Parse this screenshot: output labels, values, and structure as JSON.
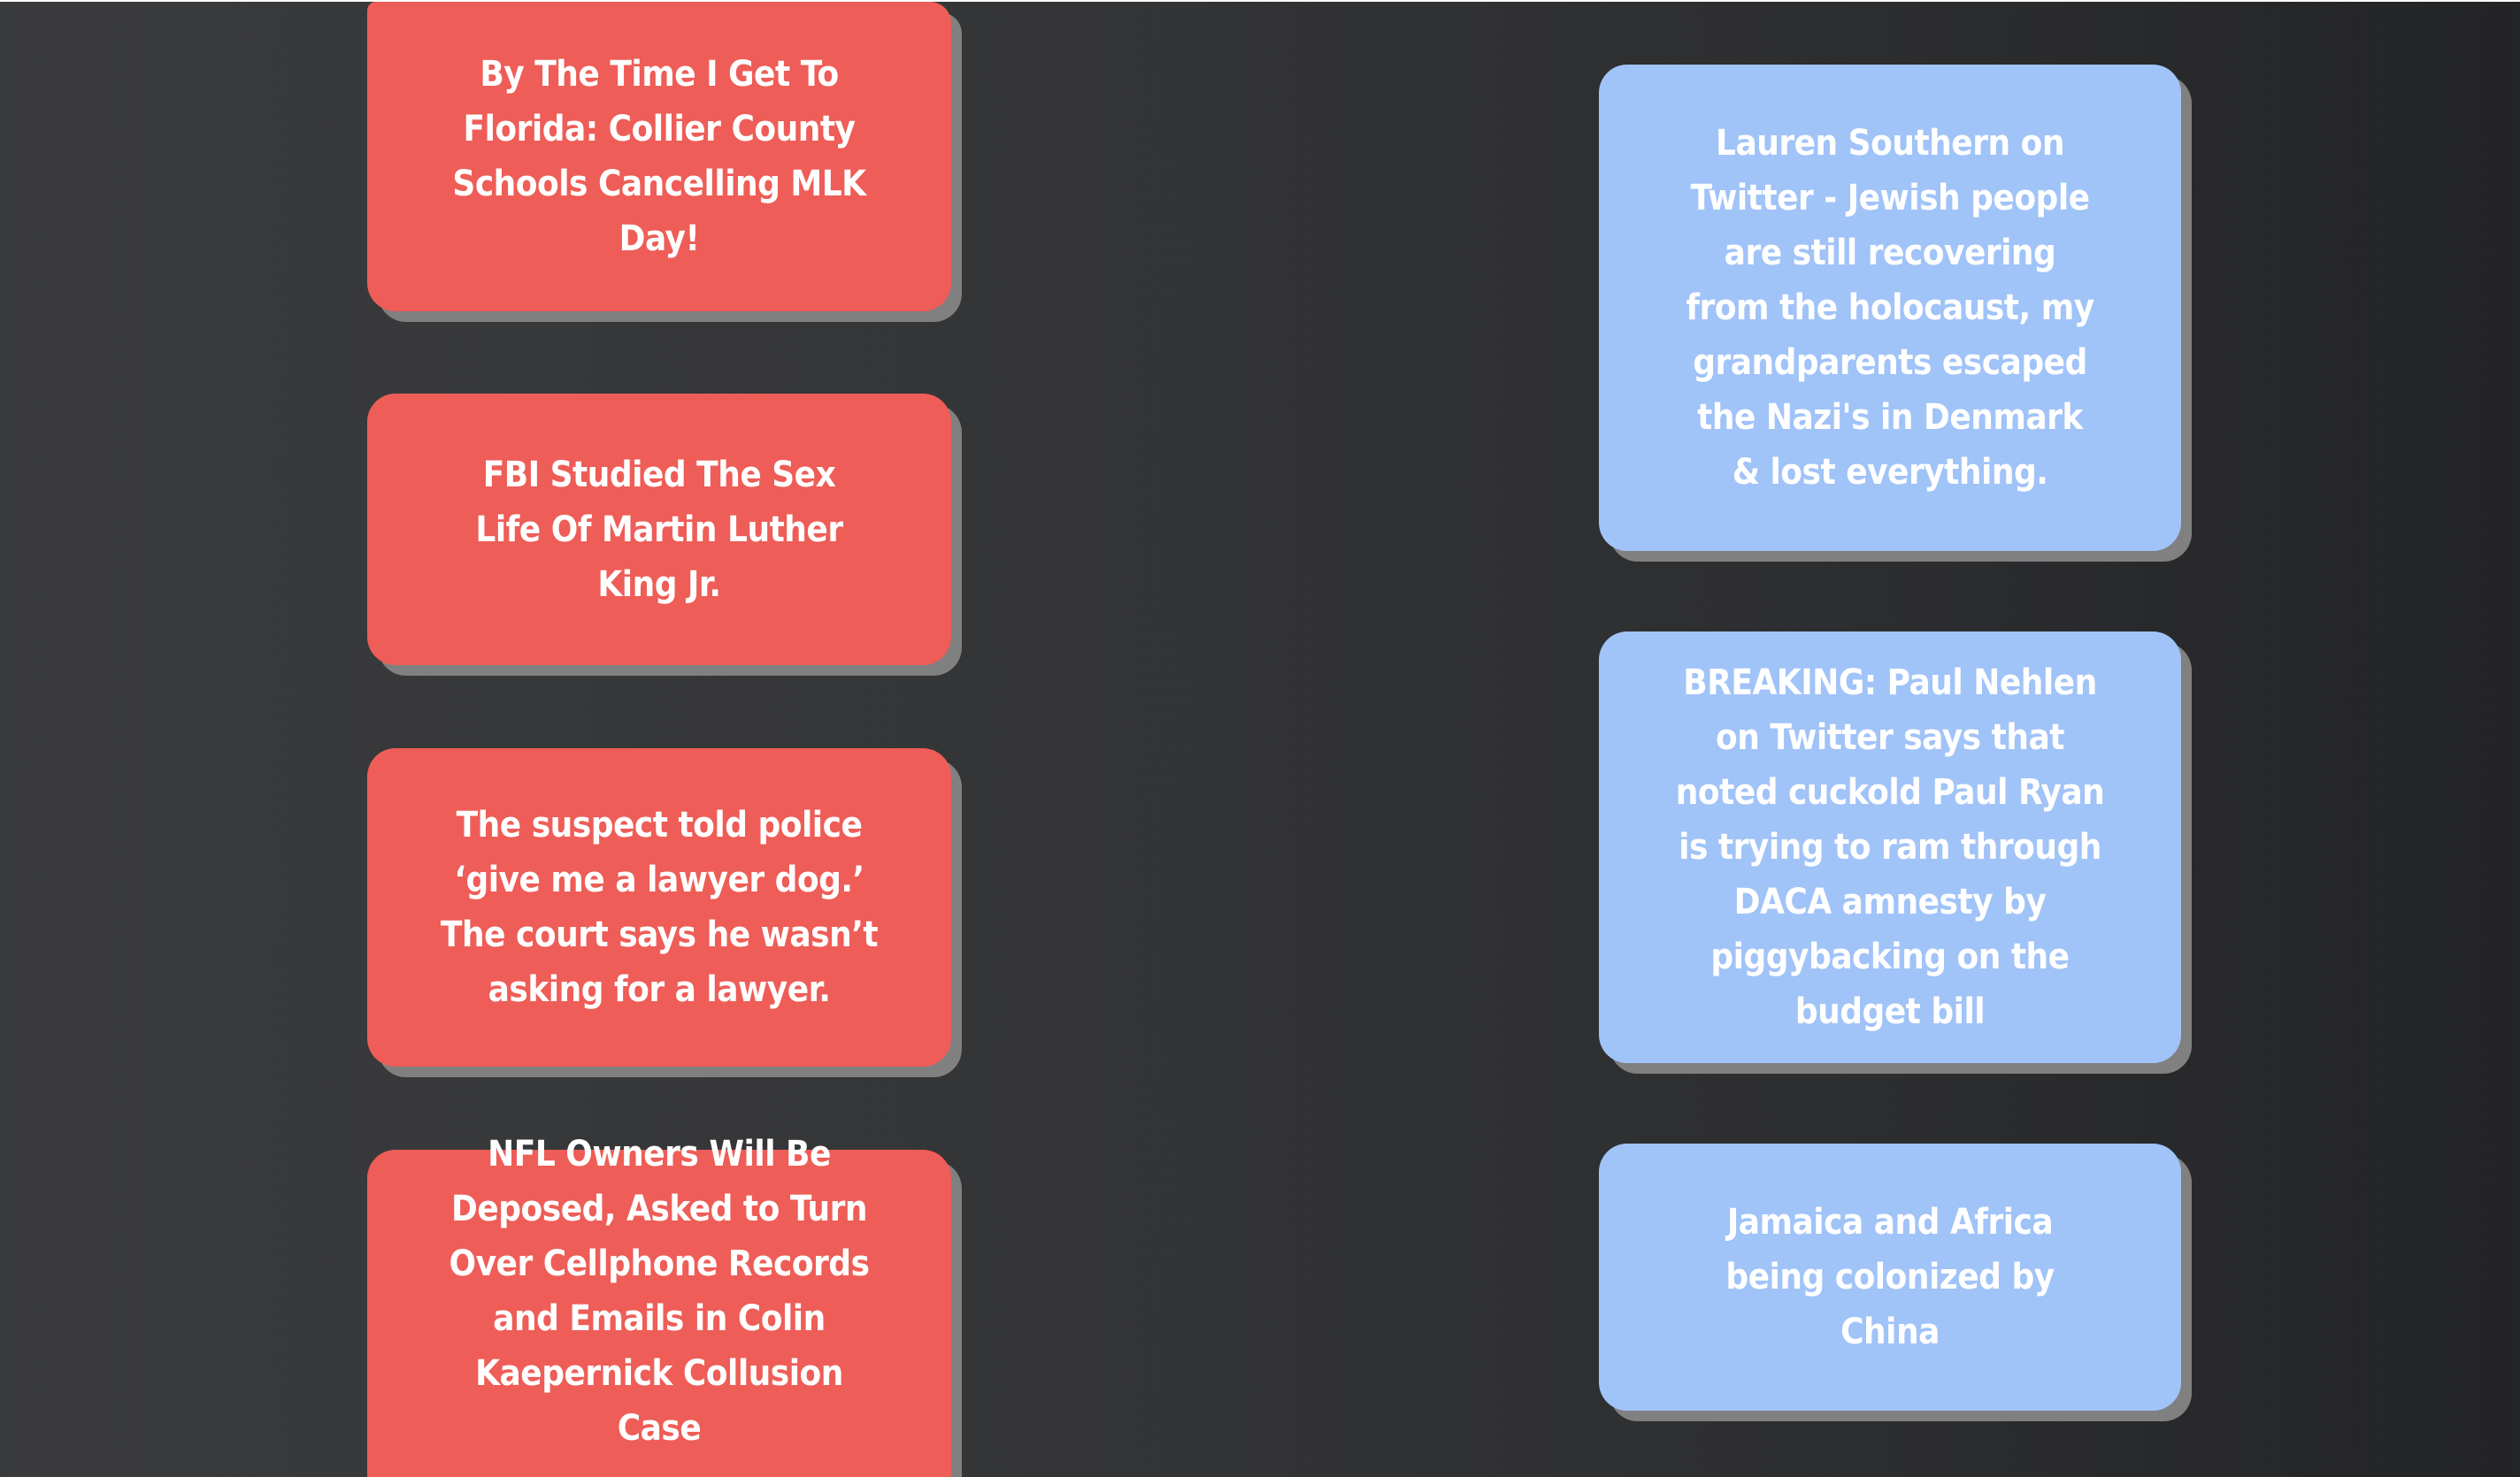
{
  "left_column": {
    "cards": [
      {
        "text": "By The Time I Get To Florida: Collier County Schools Cancelling MLK Day!"
      },
      {
        "text": "FBI Studied The Sex Life Of Martin Luther King Jr."
      },
      {
        "text": "The suspect told police ‘give me a lawyer dog.’ The court says he wasn’t asking for a lawyer."
      },
      {
        "text": "NFL Owners Will Be Deposed, Asked to Turn Over Cellphone Records and Emails in Colin Kaepernick Collusion Case"
      }
    ]
  },
  "right_column": {
    "cards": [
      {
        "text": "Lauren Southern on Twitter - Jewish people are still recovering from the holocaust, my grandparents escaped the Nazi's in Denmark & lost everything."
      },
      {
        "text": "BREAKING: Paul Nehlen on Twitter says that noted cuckold Paul Ryan is trying to ram through DACA amnesty by piggybacking on the budget bill"
      },
      {
        "text": "Jamaica and Africa being colonized by China"
      }
    ]
  },
  "colors": {
    "red_card": "#ee5d57",
    "blue_card": "#a0c3f8",
    "card_shadow": "#808080",
    "background": "#333436"
  }
}
